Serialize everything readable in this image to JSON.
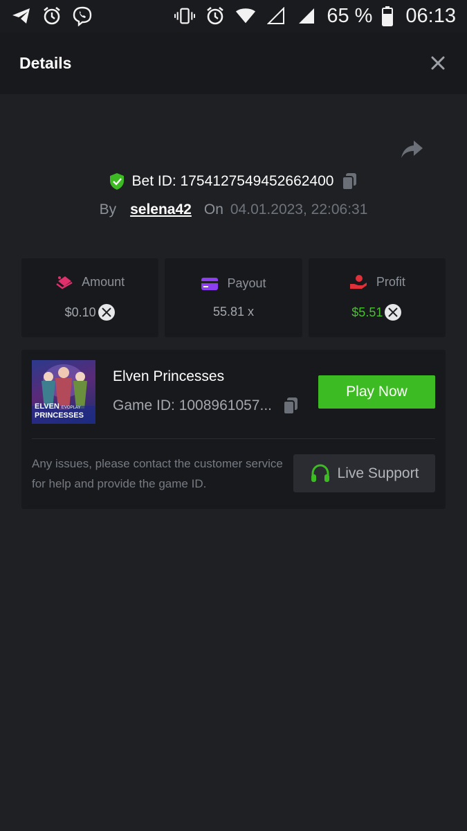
{
  "status_bar": {
    "battery_percent": "65 %",
    "time": "06:13"
  },
  "header": {
    "title": "Details"
  },
  "bet": {
    "id_label": "Bet ID: 1754127549452662400",
    "by_label": "By",
    "username": "selena42",
    "on_label": "On",
    "date": "04.01.2023, 22:06:31"
  },
  "stats": [
    {
      "label": "Amount",
      "value": "$0.10",
      "icon": "amount-icon",
      "has_coin": true
    },
    {
      "label": "Payout",
      "value": "55.81 x",
      "icon": "payout-card-icon",
      "has_coin": false
    },
    {
      "label": "Profit",
      "value": "$5.51",
      "icon": "profit-hand-icon",
      "has_coin": true
    }
  ],
  "game": {
    "name": "Elven Princesses",
    "id_label": "Game ID: 1008961057...",
    "thumb_line1": "ELVEN",
    "thumb_line2": "PRINCESSES",
    "thumb_brand": "EVOPLAY",
    "play_label": "Play Now"
  },
  "support": {
    "notice": "Any issues, please contact the customer service for help and provide the game ID.",
    "button_label": "Live Support"
  },
  "colors": {
    "background": "#1f2024",
    "card": "#18191c",
    "accent_green": "#3dbb22",
    "profit_green": "#45c12a"
  }
}
